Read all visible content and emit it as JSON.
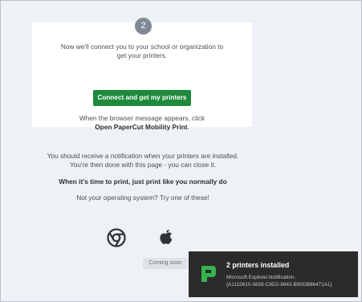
{
  "step": {
    "number": "2"
  },
  "card": {
    "intro_line1": "Now we'll connect you to your school or organization to",
    "intro_line2": "get your printers.",
    "connect_button": "Connect and get my printers",
    "browser_line1": "When the browser message appears, click",
    "browser_bold": "Open PaperCut Mobility Print",
    "browser_period": "."
  },
  "notice": {
    "line1": "You should receive a notification when your printers are installed.",
    "line2": "You're then done with this page - you can close it."
  },
  "print_like": "When it's time to print, just print like you normally do",
  "not_your_os": "Not your operating system? Try one of these!",
  "os_options": [
    {
      "icon": "chrome-icon"
    },
    {
      "icon": "apple-icon",
      "badge": "Coming soon"
    }
  ],
  "toast": {
    "title": "2 printers installed",
    "source": "Microsoft.Explorer.Notification.",
    "id": "{A1115610-5658-C8D2-9843-B90DB86471A1}",
    "logo": "papercut-logo-icon"
  },
  "colors": {
    "accent_green": "#1e8a3c",
    "toast_bg": "#2b2b2b",
    "logo_green": "#37b24d"
  }
}
